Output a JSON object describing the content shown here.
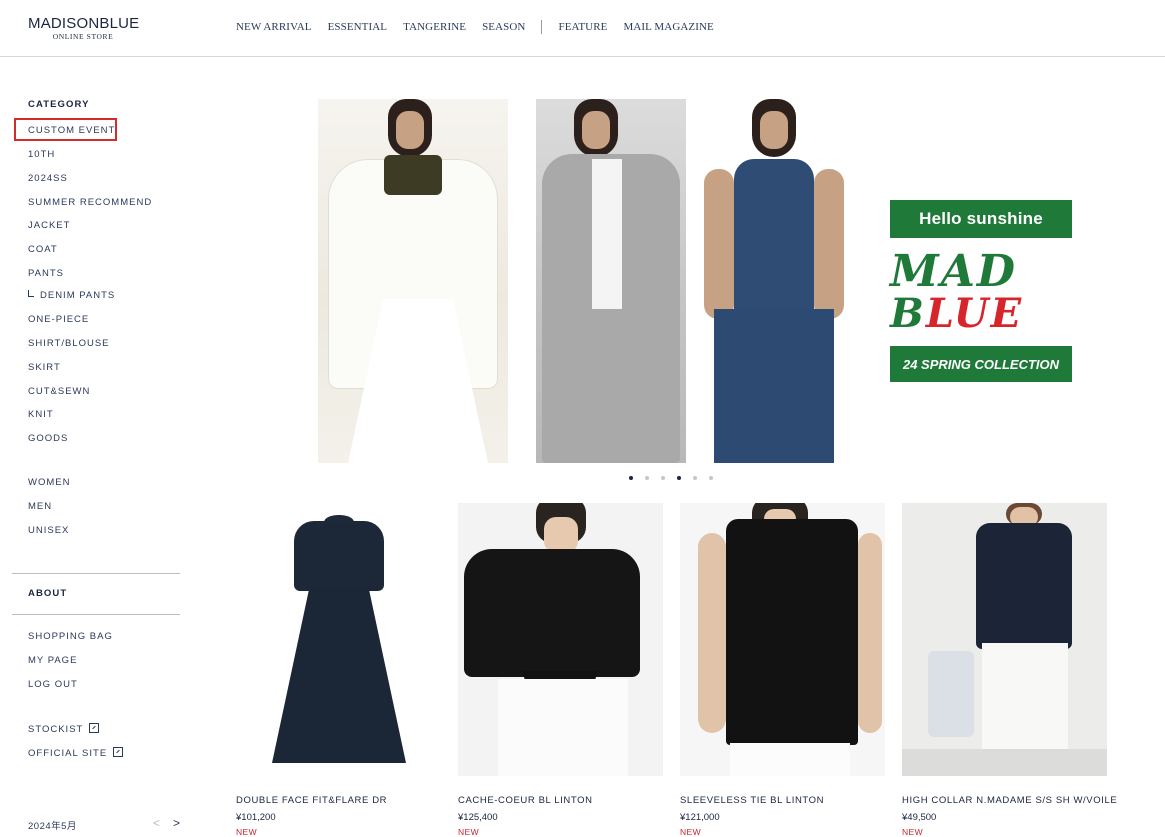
{
  "header": {
    "logo_main": "MADISONBLUE",
    "logo_sub": "ONLINE STORE",
    "nav_left": [
      "NEW ARRIVAL",
      "ESSENTIAL",
      "TANGERINE",
      "SEASON"
    ],
    "nav_right": [
      "FEATURE",
      "MAIL MAGAZINE"
    ]
  },
  "sidebar": {
    "category_heading": "CATEGORY",
    "categories": [
      "CUSTOM EVENT",
      "10TH",
      "2024SS",
      "SUMMER RECOMMEND",
      "JACKET",
      "COAT",
      "PANTS",
      "DENIM PANTS",
      "ONE-PIECE",
      "SHIRT/BLOUSE",
      "SKIRT",
      "CUT&SEWN",
      "KNIT",
      "GOODS"
    ],
    "genders": [
      "WOMEN",
      "MEN",
      "UNISEX"
    ],
    "about": "ABOUT",
    "account_links": [
      "SHOPPING BAG",
      "MY PAGE",
      "LOG OUT"
    ],
    "external_links": [
      "STOCKIST",
      "OFFICIAL SITE"
    ],
    "calendar_title": "2024年5月",
    "calendar_prev": "<",
    "calendar_next": ">"
  },
  "hero": {
    "banner_top": "Hello sunshine",
    "banner_logo_row1": "MAD",
    "banner_logo_row2a": "B",
    "banner_logo_row2b": "LUE",
    "banner_bottom": "24 SPRING COLLECTION",
    "slide_count": 6,
    "active_slide": 4
  },
  "products": [
    {
      "name": "DOUBLE FACE FIT&FLARE DR",
      "price": "¥101,200",
      "badge": "NEW"
    },
    {
      "name": "CACHE-COEUR BL LINTON",
      "price": "¥125,400",
      "badge": "NEW"
    },
    {
      "name": "SLEEVELESS TIE BL LINTON",
      "price": "¥121,000",
      "badge": "NEW"
    },
    {
      "name": "HIGH COLLAR N.MADAME S/S SH W/VOILE",
      "price": "¥49,500",
      "badge": "NEW"
    }
  ],
  "colors": {
    "brand_green": "#1f7a3a",
    "brand_red": "#d6262c",
    "text_navy": "#1a2540",
    "highlight": "#d62b2b"
  }
}
